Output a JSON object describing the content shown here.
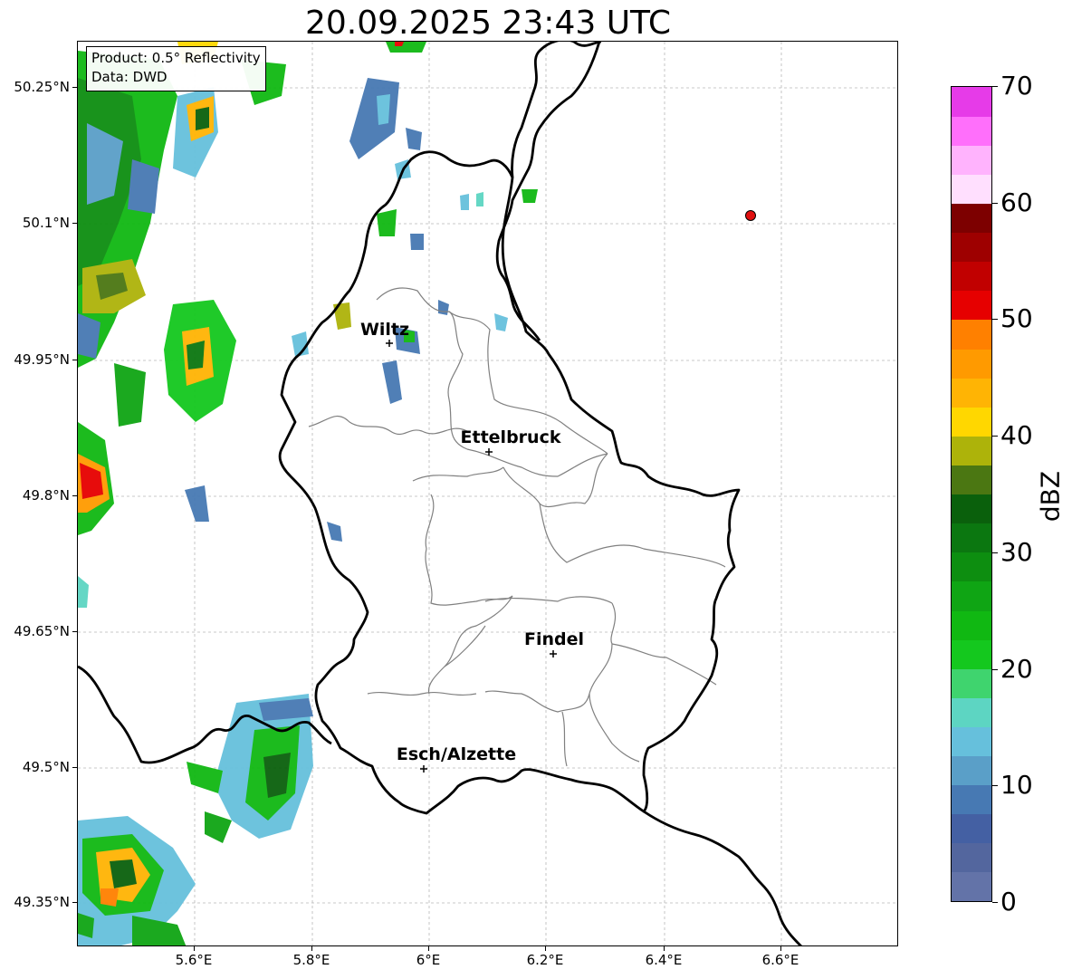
{
  "title": "20.09.2025 23:43 UTC",
  "info_box": {
    "product": "Product: 0.5° Reflectivity",
    "source": "Data: DWD"
  },
  "axes": {
    "lat_labels": [
      "50.25°N",
      "50.1°N",
      "49.95°N",
      "49.8°N",
      "49.65°N",
      "49.5°N",
      "49.35°N"
    ],
    "lon_labels": [
      "5.6°E",
      "5.8°E",
      "6°E",
      "6.2°E",
      "6.4°E",
      "6.6°E"
    ],
    "grid": true
  },
  "cities": [
    {
      "name": "Wiltz"
    },
    {
      "name": "Ettelbruck"
    },
    {
      "name": "Findel"
    },
    {
      "name": "Esch/Alzette"
    }
  ],
  "radar_marker": {
    "color": "#e01010"
  },
  "colorbar": {
    "label": "dBZ",
    "tick_labels": [
      "0",
      "10",
      "20",
      "30",
      "40",
      "50",
      "60",
      "70"
    ],
    "range": [
      0,
      70
    ],
    "step": 2.5,
    "colors": [
      "#6373a8",
      "#53669e",
      "#4460a3",
      "#4779b3",
      "#5a9fc8",
      "#66c0dc",
      "#5dd5c2",
      "#3fd46e",
      "#14c81e",
      "#10b812",
      "#0fa514",
      "#0d8e10",
      "#0b7710",
      "#0a600c",
      "#4b7712",
      "#adb30a",
      "#ffd700",
      "#ffb404",
      "#ff9a00",
      "#ff8000",
      "#e60000",
      "#c10000",
      "#9e0000",
      "#7d0000",
      "#ffdffe",
      "#ffb3fd",
      "#ff6ffb",
      "#e63be8"
    ]
  }
}
